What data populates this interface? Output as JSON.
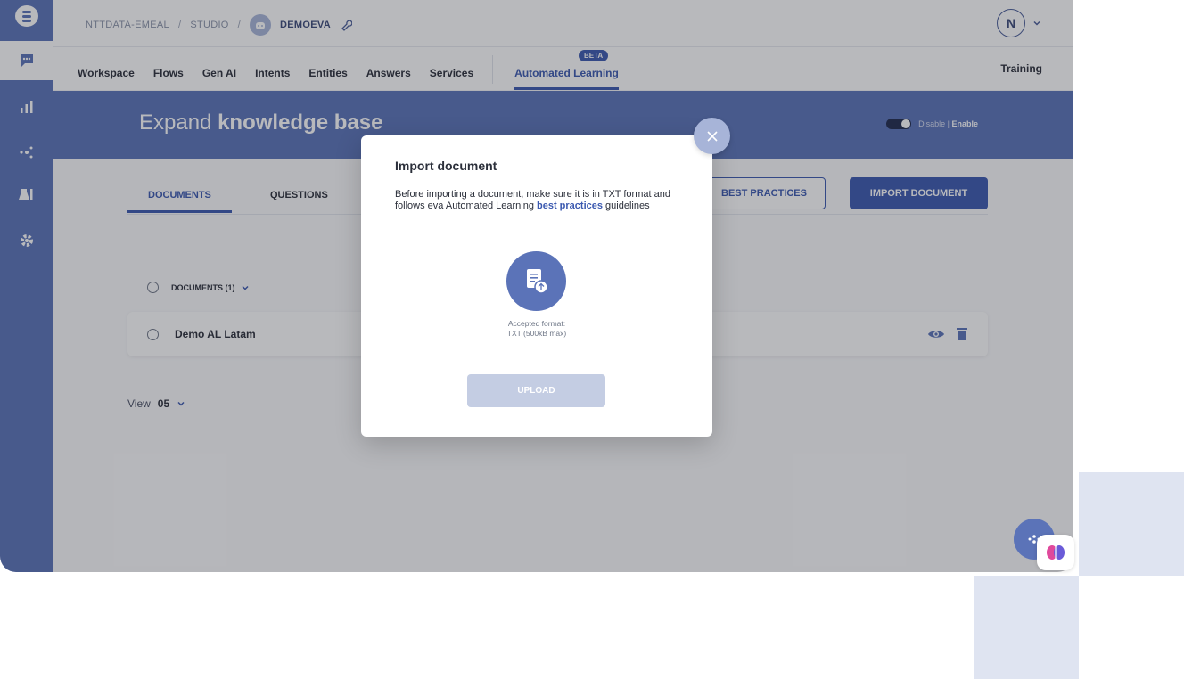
{
  "breadcrumb": {
    "org": "NTTDATA-EMEAL",
    "project": "STUDIO",
    "bot": "DEMOEVA"
  },
  "user": {
    "initial": "N"
  },
  "nav": {
    "items": [
      "Workspace",
      "Flows",
      "Gen AI",
      "Intents",
      "Entities",
      "Answers",
      "Services"
    ],
    "active": "Automated Learning",
    "badge": "BETA",
    "right": "Training"
  },
  "banner": {
    "title_light": "Expand",
    "title_bold": "knowledge base",
    "toggle_off": "Disable",
    "toggle_on": "Enable"
  },
  "tabs": {
    "documents": "DOCUMENTS",
    "questions": "QUESTIONS"
  },
  "buttons": {
    "best_practices": "BEST PRACTICES",
    "import_document": "IMPORT DOCUMENT"
  },
  "list": {
    "header": "DOCUMENTS (1)",
    "rows": [
      "Demo AL Latam"
    ]
  },
  "pagination": {
    "label": "View",
    "value": "05"
  },
  "modal": {
    "title": "Import document",
    "desc_before": "Before importing a document, make sure it is in TXT format and follows eva Automated Learning ",
    "desc_link": "best practices",
    "desc_after": " guidelines",
    "format_line1": "Accepted format:",
    "format_line2": "TXT (500kB max)",
    "upload": "UPLOAD"
  },
  "colors": {
    "primary": "#3b59b0",
    "sidebar": "#5b73b8",
    "banner": "#5b73b8",
    "upload_disabled": "#c4cde3"
  },
  "icons": [
    "chat-logo-icon",
    "chat-bubble-icon",
    "bar-chart-icon",
    "network-icon",
    "lab-icon",
    "gear-icon",
    "robot-icon",
    "wrench-icon",
    "chevron-down-icon",
    "eye-icon",
    "trash-icon",
    "document-upload-icon",
    "close-icon",
    "brain-icon"
  ]
}
